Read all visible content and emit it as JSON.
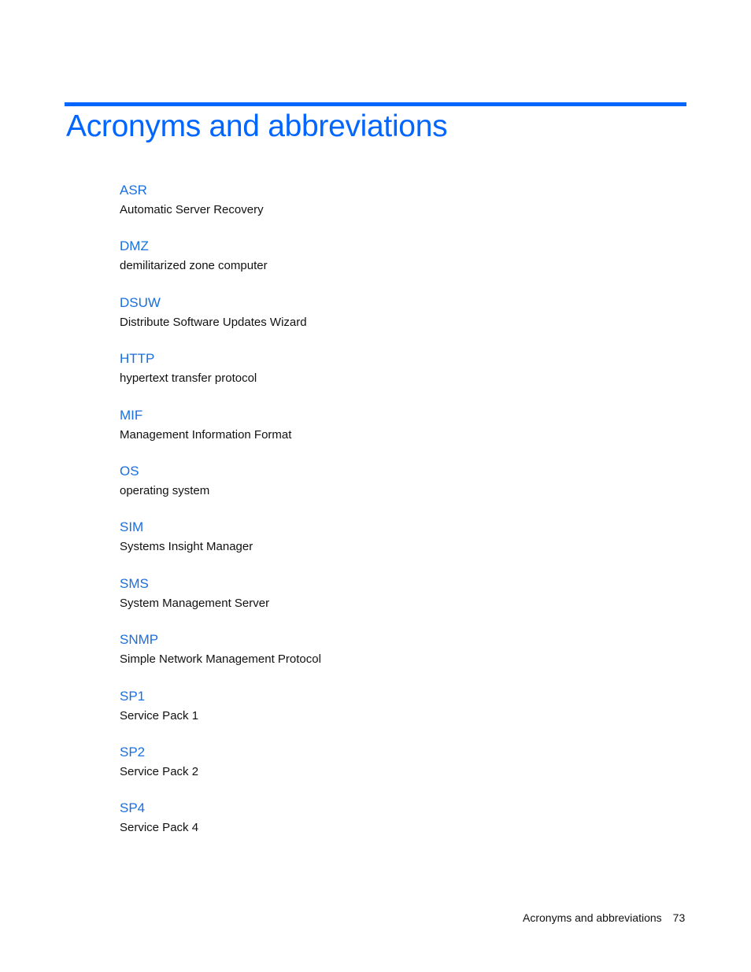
{
  "page": {
    "title": "Acronyms and abbreviations",
    "accent_color": "#0066ff",
    "entries": [
      {
        "term": "ASR",
        "definition": "Automatic Server Recovery"
      },
      {
        "term": "DMZ",
        "definition": "demilitarized zone computer"
      },
      {
        "term": "DSUW",
        "definition": "Distribute Software Updates Wizard"
      },
      {
        "term": "HTTP",
        "definition": "hypertext transfer protocol"
      },
      {
        "term": "MIF",
        "definition": "Management Information Format"
      },
      {
        "term": "OS",
        "definition": "operating system"
      },
      {
        "term": "SIM",
        "definition": "Systems Insight Manager"
      },
      {
        "term": "SMS",
        "definition": "System Management Server"
      },
      {
        "term": "SNMP",
        "definition": "Simple Network Management Protocol"
      },
      {
        "term": "SP1",
        "definition": "Service Pack 1"
      },
      {
        "term": "SP2",
        "definition": "Service Pack 2"
      },
      {
        "term": "SP4",
        "definition": "Service Pack 4"
      }
    ]
  },
  "footer": {
    "section_title": "Acronyms and abbreviations",
    "page_number": "73"
  }
}
